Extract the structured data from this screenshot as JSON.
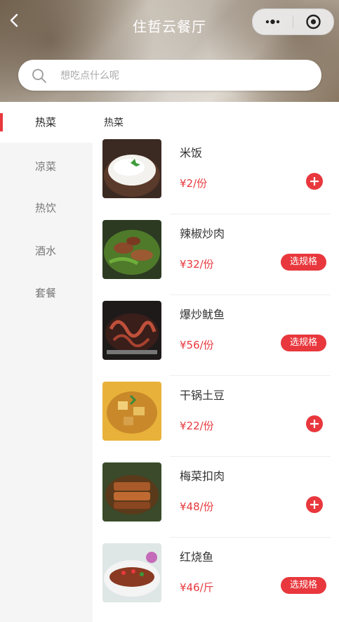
{
  "header": {
    "title": "住哲云餐厅"
  },
  "search": {
    "placeholder": "想吃点什么呢"
  },
  "sidebar": {
    "items": [
      {
        "label": "热菜"
      },
      {
        "label": "凉菜"
      },
      {
        "label": "热饮"
      },
      {
        "label": "酒水"
      },
      {
        "label": "套餐"
      }
    ]
  },
  "section": {
    "title": "热菜"
  },
  "items": [
    {
      "name": "米饭",
      "price": "¥2/份",
      "action": "add"
    },
    {
      "name": "辣椒炒肉",
      "price": "¥32/份",
      "action": "spec",
      "spec_label": "选规格"
    },
    {
      "name": "爆炒鱿鱼",
      "price": "¥56/份",
      "action": "spec",
      "spec_label": "选规格"
    },
    {
      "name": "干锅土豆",
      "price": "¥22/份",
      "action": "add"
    },
    {
      "name": "梅菜扣肉",
      "price": "¥48/份",
      "action": "add"
    },
    {
      "name": "红烧鱼",
      "price": "¥46/斤",
      "action": "spec",
      "spec_label": "选规格"
    }
  ],
  "colors": {
    "accent": "#e8383d",
    "sidebar_bg": "#f5f5f5"
  }
}
